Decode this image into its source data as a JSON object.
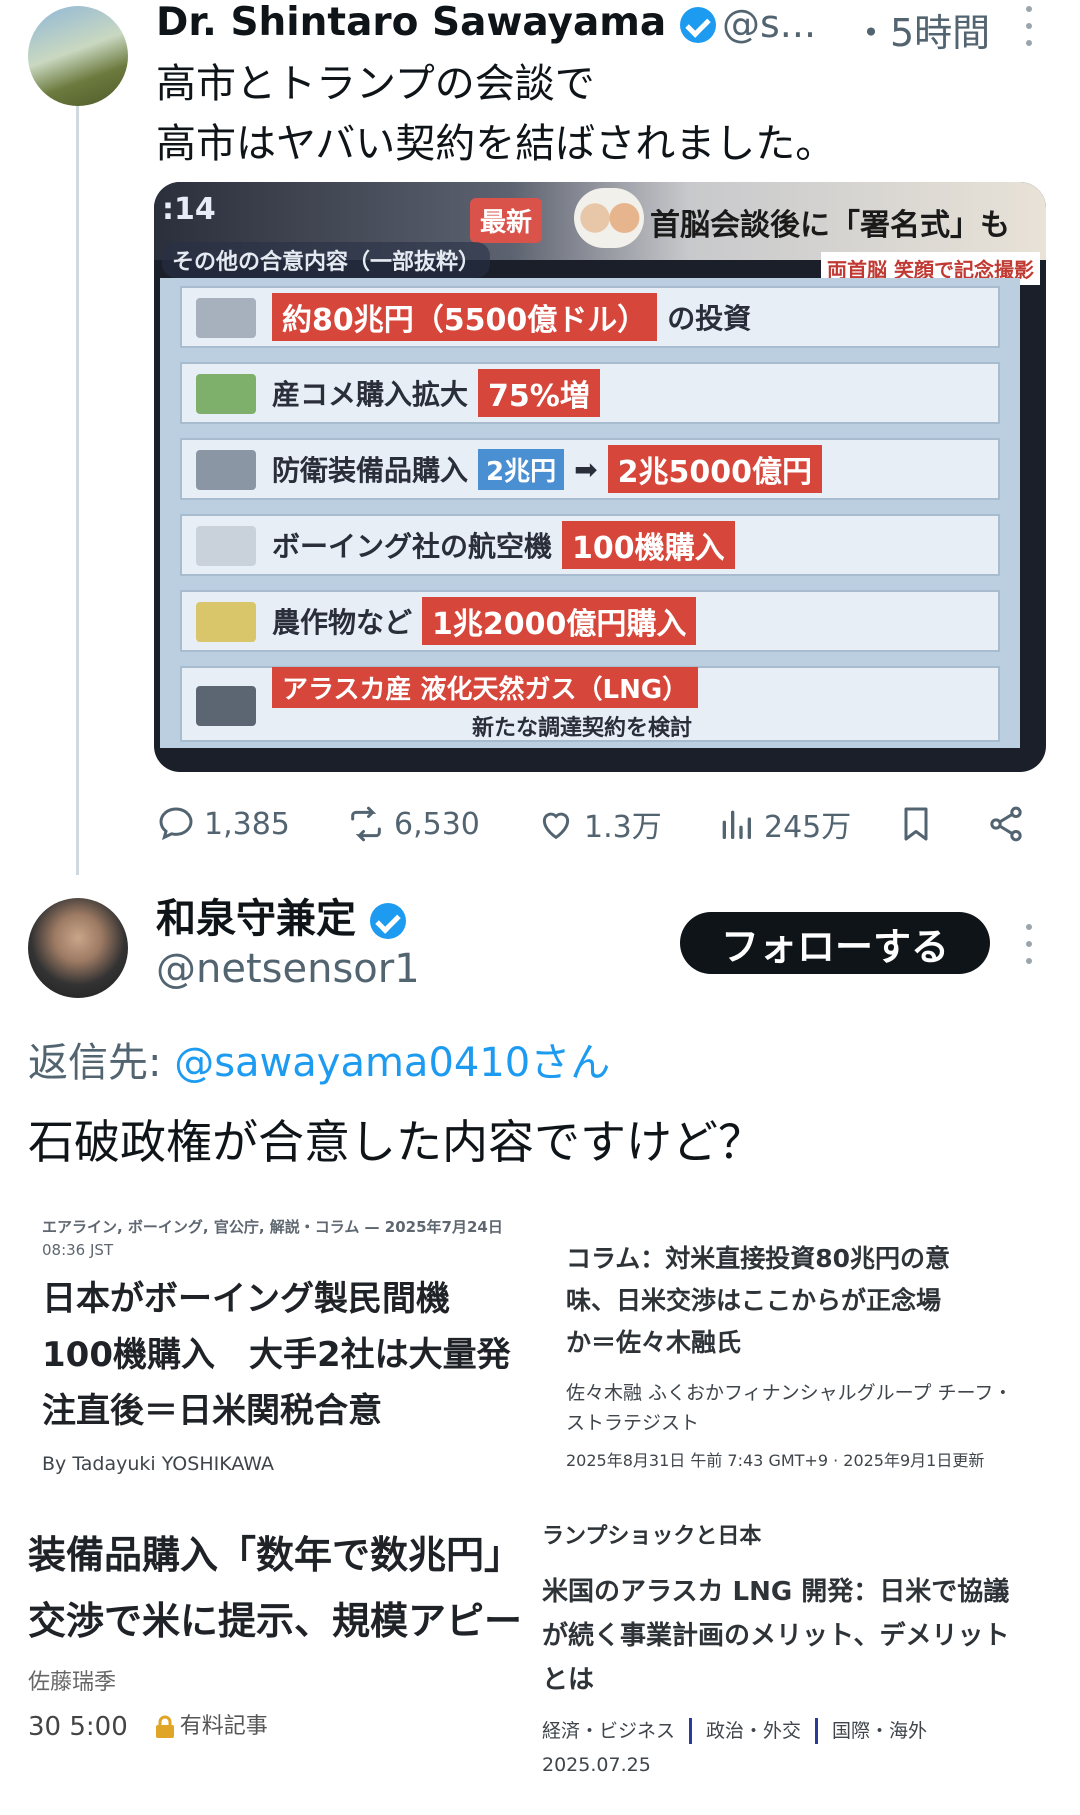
{
  "tweet1": {
    "display_name": "Dr. Shintaro Sawayama",
    "handle": "@s...",
    "time": "・5時間",
    "lines": [
      "高市とトランプの会談で",
      "高市はヤバい契約を結ばされました。"
    ],
    "media": {
      "clock": ":14",
      "badge": "最新",
      "headline": "首脳会談後に「署名式」も",
      "subheadline": "両首脳 笑顔で記念撮影",
      "board_label": "その他の合意内容（一部抜粋）",
      "rows": [
        {
          "icon": "money-icon",
          "parts": [
            {
              "style": "red",
              "text": "約80兆円（5500億ドル）"
            },
            {
              "style": "txt",
              "text": "の投資"
            }
          ]
        },
        {
          "icon": "rice-bag-icon",
          "parts": [
            {
              "style": "txt",
              "text": "産コメ購入拡大"
            },
            {
              "style": "red",
              "text": "75%増"
            }
          ]
        },
        {
          "icon": "warship-icon",
          "parts": [
            {
              "style": "txt",
              "text": "防衛装備品購入"
            },
            {
              "style": "blue",
              "text": "2兆円"
            },
            {
              "style": "arrow",
              "text": "➡"
            },
            {
              "style": "red",
              "text": "2兆5000億円"
            }
          ]
        },
        {
          "icon": "airplane-icon",
          "parts": [
            {
              "style": "txt",
              "text": "ボーイング社の航空機"
            },
            {
              "style": "red",
              "text": "100機購入"
            }
          ]
        },
        {
          "icon": "crops-icon",
          "parts": [
            {
              "style": "txt",
              "text": "農作物など"
            },
            {
              "style": "red",
              "text": "1兆2000億円購入"
            }
          ]
        },
        {
          "icon": "lng-tanker-icon",
          "parts": [
            {
              "style": "red",
              "text": "アラスカ産 液化天然ガス（LNG）"
            },
            {
              "style": "txt",
              "text": "新たな調達契約を検討"
            }
          ]
        }
      ]
    },
    "stats": {
      "replies": "1,385",
      "reposts": "6,530",
      "likes": "1.3万",
      "views": "245万"
    }
  },
  "tweet2": {
    "display_name": "和泉守兼定",
    "handle": "@netsensor1",
    "follow_label": "フォローする",
    "reply_prefix": "返信先: ",
    "reply_mention": "@sawayama0410さん",
    "text": "石破政権が合意した内容ですけど？"
  },
  "articles": {
    "a1": {
      "category": "エアライン, ボーイング, 官公庁, 解説・コラム — 2025年7月24日",
      "time": "08:36 JST",
      "lines": [
        "日本がボーイング製民間機",
        "100機購入　大手2社は大量発",
        "注直後＝日米関税合意"
      ],
      "byline": "By Tadayuki YOSHIKAWA"
    },
    "a2": {
      "lines": [
        "コラム：対米直接投資80兆円の意",
        "味、日米交渉はここからが正念場",
        "か＝佐々木融氏"
      ],
      "author": [
        "佐々木融 ふくおかフィナンシャルグループ チーフ・",
        "ストラテジスト"
      ],
      "date": "2025年8月31日 午前 7:43 GMT+9 · 2025年9月1日更新"
    },
    "a3": {
      "lines": [
        "装備品購入「数年で数兆円」",
        "交渉で米に提示、規模アピー"
      ],
      "author": "佐藤瑞季",
      "time": "30 5:00",
      "paywall": "有料記事"
    },
    "a4": {
      "series": "ランプショックと日本",
      "lines": [
        "米国のアラスカ LNG 開発：日米で協議",
        "が続く事業計画のメリット、デメリット",
        "とは"
      ],
      "tags": [
        "経済・ビジネス",
        "政治・外交",
        "国際・海外"
      ],
      "date": "2025.07.25"
    }
  }
}
